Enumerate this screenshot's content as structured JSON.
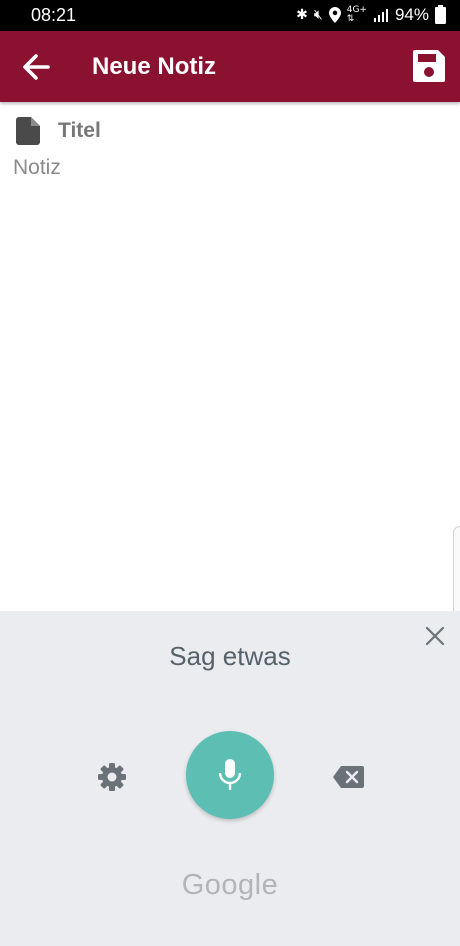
{
  "status_bar": {
    "time": "08:21",
    "battery": "94%",
    "icons": [
      "bluetooth-icon",
      "mute-icon",
      "location-icon",
      "4g-icon",
      "signal-icon",
      "battery-icon"
    ]
  },
  "app_bar": {
    "title": "Neue Notiz",
    "background_color": "#8a1230",
    "back_icon": "arrow-left-icon",
    "save_icon": "floppy-disk-icon"
  },
  "editor": {
    "title_placeholder": "Titel",
    "title_value": "",
    "note_placeholder": "Notiz",
    "note_value": ""
  },
  "voice_input": {
    "prompt": "Sag etwas",
    "brand": "Google",
    "mic_color": "#5dbfb3",
    "panel_color": "#eaecef"
  }
}
